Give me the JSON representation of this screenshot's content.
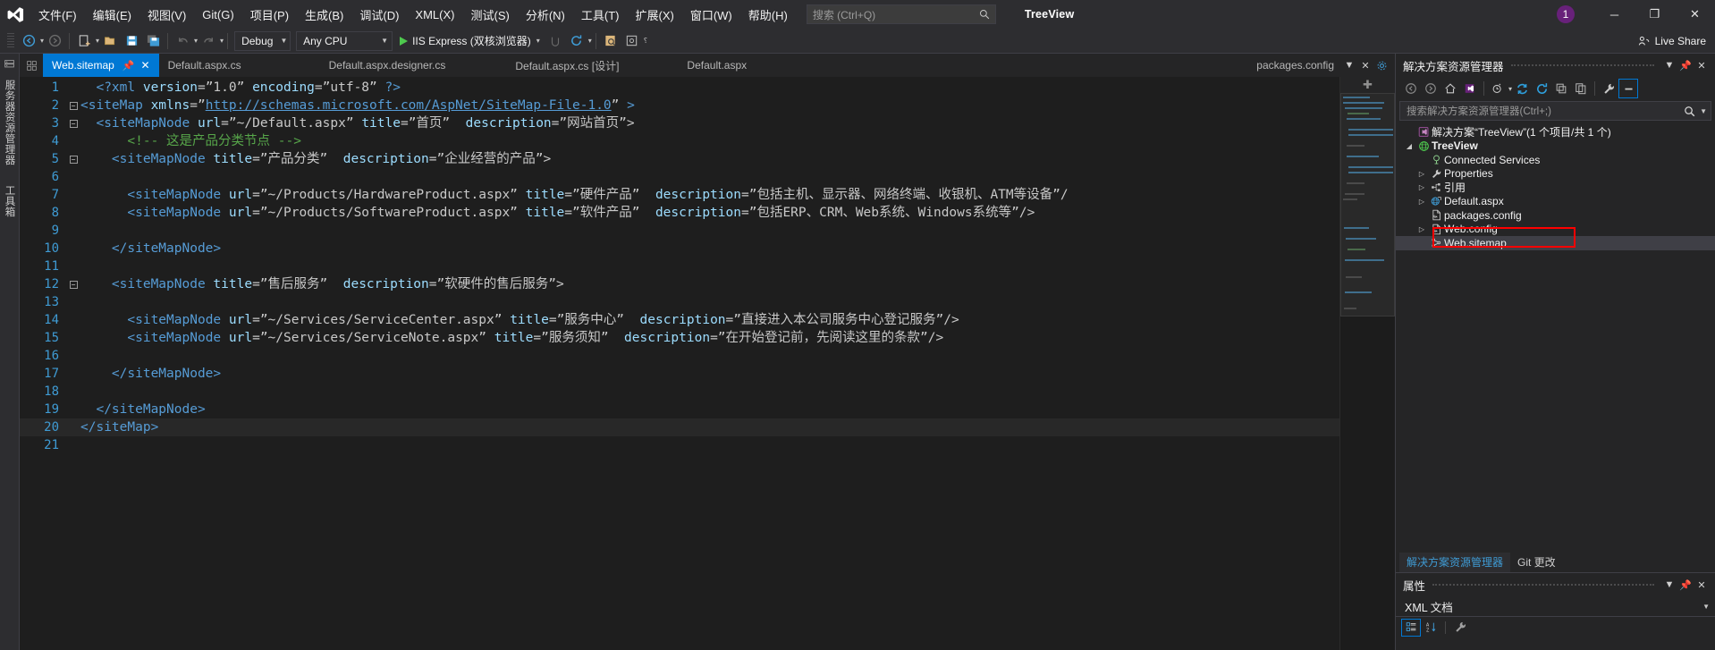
{
  "window": {
    "title": "TreeView",
    "notification_count": "1",
    "minimize": "─",
    "maximize": "❐",
    "close": "✕"
  },
  "menu": {
    "items": [
      {
        "label": "文件(F)"
      },
      {
        "label": "编辑(E)"
      },
      {
        "label": "视图(V)"
      },
      {
        "label": "Git(G)"
      },
      {
        "label": "项目(P)"
      },
      {
        "label": "生成(B)"
      },
      {
        "label": "调试(D)"
      },
      {
        "label": "XML(X)"
      },
      {
        "label": "测试(S)"
      },
      {
        "label": "分析(N)"
      },
      {
        "label": "工具(T)"
      },
      {
        "label": "扩展(X)"
      },
      {
        "label": "窗口(W)"
      },
      {
        "label": "帮助(H)"
      }
    ],
    "search_placeholder": "搜索 (Ctrl+Q)",
    "search_icon": "search-icon"
  },
  "toolbar": {
    "back_icon": "navigate-back-icon",
    "forward_icon": "navigate-forward-icon",
    "new_project_icon": "new-project-icon",
    "open_icon": "open-file-icon",
    "save_icon": "save-icon",
    "save_all_icon": "save-all-icon",
    "undo_icon": "undo-icon",
    "redo_icon": "redo-icon",
    "configuration": "Debug",
    "platform": "Any CPU",
    "run_target": "IIS Express (双核浏览器)",
    "run_icon": "play-icon",
    "attach_icon": "attach-process-icon",
    "refresh_icon": "hot-reload-icon",
    "browser_icon": "browse-with-icon",
    "preview_icon": "preview-icon",
    "overflow": "⸮",
    "live_share": "Live Share",
    "live_share_icon": "live-share-icon"
  },
  "left_rail": {
    "tabs": [
      {
        "label": "服务器资源管理器",
        "icon": "server-explorer-icon"
      },
      {
        "label": "工具箱",
        "icon": "toolbox-icon"
      }
    ]
  },
  "editor_tabs": {
    "dock_icon": "tab-list-icon",
    "items": [
      {
        "label": "Web.sitemap",
        "active": true,
        "pin_icon": "pin-icon",
        "close_icon": "close-icon"
      },
      {
        "label": "Default.aspx.cs",
        "active": false
      },
      {
        "label": "Default.aspx.designer.cs",
        "active": false
      },
      {
        "label": "Default.aspx.cs [设计]",
        "active": false
      },
      {
        "label": "Default.aspx",
        "active": false
      }
    ],
    "right_tab": "packages.config",
    "right_icons": [
      "chevron-down-icon",
      "close-icon",
      "gear-icon"
    ]
  },
  "code": {
    "minimap_top_icon": "✚",
    "current_line": 20,
    "lines": [
      {
        "n": 1,
        "fold": "",
        "tokens": [
          {
            "t": "  ",
            "c": "plain"
          },
          {
            "t": "<?xml ",
            "c": "tag"
          },
          {
            "t": "version",
            "c": "attr"
          },
          {
            "t": "=”1.0” ",
            "c": "val"
          },
          {
            "t": "encoding",
            "c": "attr"
          },
          {
            "t": "=”utf-8” ",
            "c": "val"
          },
          {
            "t": "?>",
            "c": "tag"
          }
        ]
      },
      {
        "n": 2,
        "fold": "minus",
        "tokens": [
          {
            "t": "<siteMap ",
            "c": "tag"
          },
          {
            "t": "xmlns",
            "c": "attr"
          },
          {
            "t": "=”",
            "c": "val"
          },
          {
            "t": "http://schemas.microsoft.com/AspNet/SiteMap-File-1.0",
            "c": "link"
          },
          {
            "t": "” ",
            "c": "val"
          },
          {
            "t": ">",
            "c": "tag"
          }
        ]
      },
      {
        "n": 3,
        "fold": "minus",
        "tokens": [
          {
            "t": "  ",
            "c": "plain"
          },
          {
            "t": "<siteMapNode ",
            "c": "tag"
          },
          {
            "t": "url",
            "c": "attr"
          },
          {
            "t": "=”~/Default.aspx” ",
            "c": "val"
          },
          {
            "t": "title",
            "c": "attr"
          },
          {
            "t": "=”首页”  ",
            "c": "val"
          },
          {
            "t": "description",
            "c": "attr"
          },
          {
            "t": "=”网站首页”>",
            "c": "val"
          }
        ]
      },
      {
        "n": 4,
        "fold": "line",
        "tokens": [
          {
            "t": "      ",
            "c": "plain"
          },
          {
            "t": "<!-- 这是产品分类节点 -->",
            "c": "cmt"
          }
        ]
      },
      {
        "n": 5,
        "fold": "minus",
        "tokens": [
          {
            "t": "    ",
            "c": "plain"
          },
          {
            "t": "<siteMapNode ",
            "c": "tag"
          },
          {
            "t": "title",
            "c": "attr"
          },
          {
            "t": "=”产品分类”  ",
            "c": "val"
          },
          {
            "t": "description",
            "c": "attr"
          },
          {
            "t": "=”企业经营的产品”>",
            "c": "val"
          }
        ]
      },
      {
        "n": 6,
        "fold": "line",
        "tokens": []
      },
      {
        "n": 7,
        "fold": "line",
        "tokens": [
          {
            "t": "      ",
            "c": "plain"
          },
          {
            "t": "<siteMapNode ",
            "c": "tag"
          },
          {
            "t": "url",
            "c": "attr"
          },
          {
            "t": "=”~/Products/HardwareProduct.aspx” ",
            "c": "val"
          },
          {
            "t": "title",
            "c": "attr"
          },
          {
            "t": "=”硬件产品”  ",
            "c": "val"
          },
          {
            "t": "description",
            "c": "attr"
          },
          {
            "t": "=”包括主机、显示器、网络终端、收银机、ATM等设备”/",
            "c": "val"
          }
        ]
      },
      {
        "n": 8,
        "fold": "line",
        "tokens": [
          {
            "t": "      ",
            "c": "plain"
          },
          {
            "t": "<siteMapNode ",
            "c": "tag"
          },
          {
            "t": "url",
            "c": "attr"
          },
          {
            "t": "=”~/Products/SoftwareProduct.aspx” ",
            "c": "val"
          },
          {
            "t": "title",
            "c": "attr"
          },
          {
            "t": "=”软件产品”  ",
            "c": "val"
          },
          {
            "t": "description",
            "c": "attr"
          },
          {
            "t": "=”包括ERP、CRM、Web系统、Windows系统等”/>",
            "c": "val"
          }
        ]
      },
      {
        "n": 9,
        "fold": "line",
        "tokens": []
      },
      {
        "n": 10,
        "fold": "line",
        "tokens": [
          {
            "t": "    ",
            "c": "plain"
          },
          {
            "t": "</siteMapNode>",
            "c": "tag"
          }
        ]
      },
      {
        "n": 11,
        "fold": "line",
        "tokens": []
      },
      {
        "n": 12,
        "fold": "minus",
        "tokens": [
          {
            "t": "    ",
            "c": "plain"
          },
          {
            "t": "<siteMapNode ",
            "c": "tag"
          },
          {
            "t": "title",
            "c": "attr"
          },
          {
            "t": "=”售后服务”  ",
            "c": "val"
          },
          {
            "t": "description",
            "c": "attr"
          },
          {
            "t": "=”软硬件的售后服务”>",
            "c": "val"
          }
        ]
      },
      {
        "n": 13,
        "fold": "line",
        "tokens": []
      },
      {
        "n": 14,
        "fold": "line",
        "tokens": [
          {
            "t": "      ",
            "c": "plain"
          },
          {
            "t": "<siteMapNode ",
            "c": "tag"
          },
          {
            "t": "url",
            "c": "attr"
          },
          {
            "t": "=”~/Services/ServiceCenter.aspx” ",
            "c": "val"
          },
          {
            "t": "title",
            "c": "attr"
          },
          {
            "t": "=”服务中心”  ",
            "c": "val"
          },
          {
            "t": "description",
            "c": "attr"
          },
          {
            "t": "=”直接进入本公司服务中心登记服务”/>",
            "c": "val"
          }
        ]
      },
      {
        "n": 15,
        "fold": "line",
        "tokens": [
          {
            "t": "      ",
            "c": "plain"
          },
          {
            "t": "<siteMapNode ",
            "c": "tag"
          },
          {
            "t": "url",
            "c": "attr"
          },
          {
            "t": "=”~/Services/ServiceNote.aspx” ",
            "c": "val"
          },
          {
            "t": "title",
            "c": "attr"
          },
          {
            "t": "=”服务须知”  ",
            "c": "val"
          },
          {
            "t": "description",
            "c": "attr"
          },
          {
            "t": "=”在开始登记前，先阅读这里的条款”/>",
            "c": "val"
          }
        ]
      },
      {
        "n": 16,
        "fold": "line",
        "tokens": []
      },
      {
        "n": 17,
        "fold": "line",
        "tokens": [
          {
            "t": "    ",
            "c": "plain"
          },
          {
            "t": "</siteMapNode>",
            "c": "tag"
          }
        ]
      },
      {
        "n": 18,
        "fold": "line",
        "tokens": []
      },
      {
        "n": 19,
        "fold": "line",
        "tokens": [
          {
            "t": "  ",
            "c": "plain"
          },
          {
            "t": "</siteMapNode>",
            "c": "tag"
          }
        ]
      },
      {
        "n": 20,
        "fold": "",
        "tokens": [
          {
            "t": "</siteMap>",
            "c": "tag"
          }
        ]
      },
      {
        "n": 21,
        "fold": "",
        "tokens": []
      }
    ]
  },
  "solution_explorer": {
    "title": "解决方案资源管理器",
    "header_icons": [
      "chevron-down-icon",
      "pin-icon",
      "close-icon"
    ],
    "toolbar_icons": [
      "navigate-back-icon",
      "navigate-forward-icon",
      "home-icon",
      "solution-icon",
      "pending-changes-icon",
      "refresh-icon",
      "sync-icon",
      "collapse-all-icon",
      "show-all-files-icon",
      "properties-icon",
      "preview-selected-items-icon"
    ],
    "search_placeholder": "搜索解决方案资源管理器(Ctrl+;)",
    "search_icon": "search-icon",
    "tree": [
      {
        "label": "解决方案“TreeView”(1 个项目/共 1 个)",
        "indent": 0,
        "twist": "",
        "icon": "solution-icon",
        "bold": false,
        "selected": false
      },
      {
        "label": "TreeView",
        "indent": 0,
        "twist": "expanded",
        "icon": "web-project-icon",
        "bold": true,
        "selected": false
      },
      {
        "label": "Connected Services",
        "indent": 1,
        "twist": "",
        "icon": "connected-services-icon",
        "bold": false,
        "selected": false
      },
      {
        "label": "Properties",
        "indent": 1,
        "twist": "collapsed",
        "icon": "properties-wrench-icon",
        "bold": false,
        "selected": false
      },
      {
        "label": "引用",
        "indent": 1,
        "twist": "collapsed",
        "icon": "references-icon",
        "bold": false,
        "selected": false
      },
      {
        "label": "Default.aspx",
        "indent": 1,
        "twist": "collapsed",
        "icon": "aspx-page-icon",
        "bold": false,
        "selected": false
      },
      {
        "label": "packages.config",
        "indent": 1,
        "twist": "",
        "icon": "config-file-icon",
        "bold": false,
        "selected": false
      },
      {
        "label": "Web.config",
        "indent": 1,
        "twist": "collapsed",
        "icon": "config-file-icon",
        "bold": false,
        "selected": false
      },
      {
        "label": "Web.sitemap",
        "indent": 1,
        "twist": "",
        "icon": "sitemap-file-icon",
        "bold": false,
        "selected": true
      }
    ],
    "annotation_color": "#ff0000"
  },
  "dock_tabs": [
    {
      "label": "解决方案资源管理器",
      "active": true
    },
    {
      "label": "Git 更改",
      "active": false
    }
  ],
  "properties": {
    "title": "属性",
    "header_icons": [
      "chevron-down-icon",
      "pin-icon",
      "close-icon"
    ],
    "selected_object": "XML 文档",
    "toolbar_icons": [
      "categorized-icon",
      "alphabetical-icon",
      "property-pages-icon"
    ]
  },
  "colors": {
    "accent": "#0078d4",
    "tag": "#569cd6",
    "attribute": "#9cdcfe",
    "comment": "#57a64a",
    "value": "#c8c8c8",
    "line_number": "#3f9bd4",
    "annotation": "#ff0000",
    "badge": "#68217a",
    "editor_bg": "#1e1e1e",
    "chrome_bg": "#2d2d30"
  }
}
